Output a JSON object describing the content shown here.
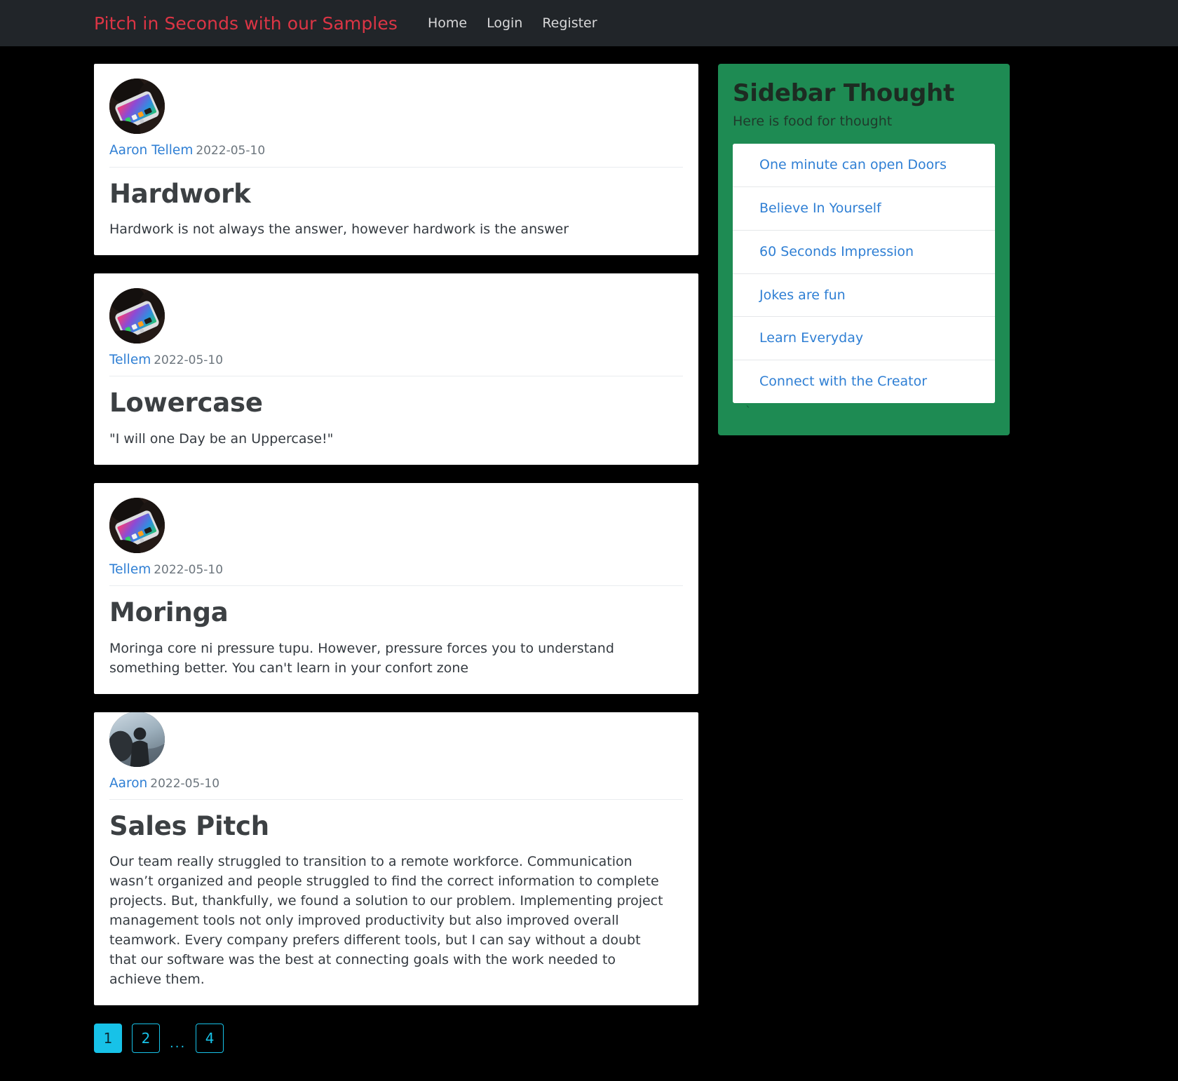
{
  "navbar": {
    "brand": "Pitch in Seconds with our Samples",
    "links": [
      {
        "label": "Home"
      },
      {
        "label": "Login"
      },
      {
        "label": "Register"
      }
    ]
  },
  "posts": [
    {
      "author": "Aaron Tellem",
      "date": "2022-05-10",
      "title": "Hardwork",
      "body": "Hardwork is not always the answer, however hardwork is the answer",
      "avatar": "phone-in-hand-photo"
    },
    {
      "author": "Tellem",
      "date": "2022-05-10",
      "title": "Lowercase",
      "body": "\"I will one Day be an Uppercase!\"",
      "avatar": "phone-in-hand-photo"
    },
    {
      "author": "Tellem",
      "date": "2022-05-10",
      "title": "Moringa",
      "body": "Moringa core ni pressure tupu. However, pressure forces you to understand something better. You can't learn in your confort zone",
      "avatar": "phone-in-hand-photo"
    },
    {
      "author": "Aaron",
      "date": "2022-05-10",
      "title": "Sales Pitch",
      "body": "Our team really struggled to transition to a remote workforce. Communication wasn’t organized and people struggled to find the correct information to complete projects. But, thankfully, we found a solution to our problem. Implementing project management tools not only improved productivity but also improved overall teamwork. Every company prefers different tools, but I can say without a doubt that our software was the best at connecting goals with the work needed to achieve them.",
      "avatar": "silhouette-photo"
    }
  ],
  "sidebar": {
    "title": "Sidebar Thought",
    "subtitle": "Here is food for thought",
    "items": [
      {
        "label": "One minute can open Doors"
      },
      {
        "label": "Believe In Yourself"
      },
      {
        "label": "60 Seconds Impression"
      },
      {
        "label": "Jokes are fun"
      },
      {
        "label": "Learn Everyday"
      },
      {
        "label": "Connect with the Creator"
      }
    ],
    "trailing_text": "`"
  },
  "pagination": {
    "pages": [
      {
        "label": "1",
        "active": true
      },
      {
        "label": "2",
        "active": false
      }
    ],
    "ellipsis": "...",
    "last": {
      "label": "4",
      "active": false
    }
  },
  "colors": {
    "navbar_bg": "#212529",
    "brand": "#dc3545",
    "page_bg": "#000000",
    "card_bg": "#ffffff",
    "sidebar_green": "#1e8b53",
    "link_blue": "#2f7fd4",
    "pagination_cyan": "#17c2e8"
  }
}
